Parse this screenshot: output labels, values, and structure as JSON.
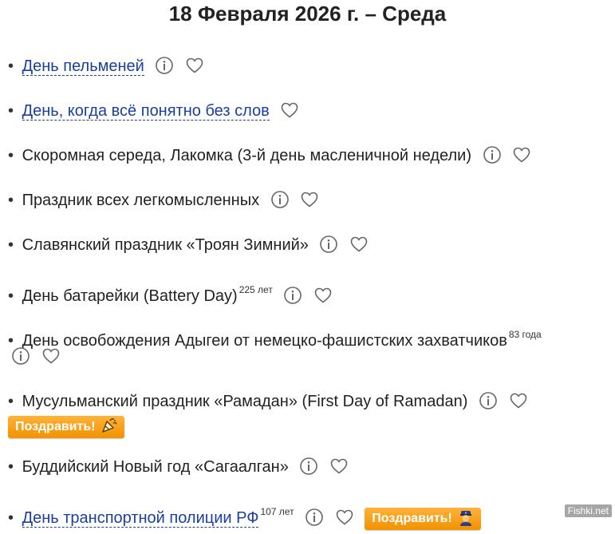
{
  "header": {
    "title": "18 Февраля 2026 г. – Среда"
  },
  "items": [
    {
      "label": "День пельменей"
    },
    {
      "label": "День, когда всё понятно без слов"
    },
    {
      "label": "Скоромная середа, Лакомка (3-й день масленичной недели)"
    },
    {
      "label": "Праздник всех легкомысленных"
    },
    {
      "label": "Славянский праздник «Троян Зимний»"
    },
    {
      "label": "День батарейки (Battery Day)",
      "years": "225 лет"
    },
    {
      "label": "День освобождения Адыгеи от немецко-фашистских захватчиков",
      "years": "83 года"
    },
    {
      "label": "Мусульманский праздник «Рамадан» (First Day of Ramadan)",
      "congratulate": "Поздравить!"
    },
    {
      "label": "Буддийский Новый год «Сагаалган»"
    },
    {
      "label": "День транспортной полиции РФ",
      "years": "107 лет",
      "congratulate": "Поздравить!"
    }
  ],
  "bullet": "•",
  "watermark": "Fishki.net",
  "colors": {
    "link": "#1a3fa0",
    "button": "#f29200",
    "icon": "#666666"
  },
  "icons": [
    "info-icon",
    "heart-icon",
    "party-popper-icon",
    "police-officer-icon"
  ]
}
